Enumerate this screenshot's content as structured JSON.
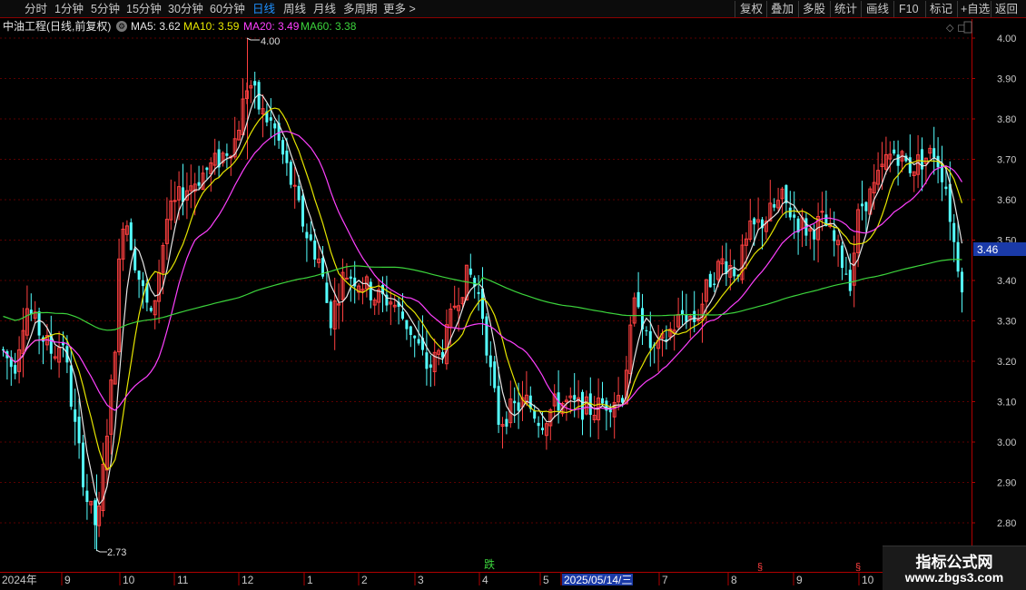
{
  "toolbar": {
    "left": [
      "分时",
      "1分钟",
      "5分钟",
      "15分钟",
      "30分钟",
      "60分钟",
      "日线",
      "周线",
      "月线",
      "多周期",
      "更多 >"
    ],
    "right": [
      "复权",
      "叠加",
      "多股",
      "统计",
      "画线",
      "F10",
      "标记",
      "+自选",
      "返回"
    ],
    "active": "日线"
  },
  "indicators": {
    "title": "中油工程(日线,前复权)",
    "ma5": "MA5: 3.62",
    "ma10": "MA10: 3.59",
    "ma20": "MA20: 3.49",
    "ma60": "MA60: 3.38"
  },
  "chart_data": {
    "type": "candlestick",
    "y_axis_labels": [
      "4.00",
      "3.90",
      "3.80",
      "3.70",
      "3.60",
      "3.50",
      "3.40",
      "3.30",
      "3.20",
      "3.10",
      "3.00",
      "2.90",
      "2.80"
    ],
    "ylim": [
      2.72,
      4.03
    ],
    "x_axis_labels": [
      "2024年",
      "9",
      "10",
      "11",
      "12",
      "1",
      "2",
      "3",
      "4",
      "5",
      "2025/05/14/三",
      "7",
      "8",
      "9",
      "10"
    ],
    "current_price": "3.46",
    "high_label": "4.00",
    "low_label": "2.73",
    "event_markers": [
      "跌",
      "§",
      "§"
    ],
    "series": [
      {
        "name": "MA5",
        "color": "#e6e6e6"
      },
      {
        "name": "MA10",
        "color": "#e6e600"
      },
      {
        "name": "MA20",
        "color": "#ff40ff"
      },
      {
        "name": "MA60",
        "color": "#3cd43c"
      }
    ],
    "colors": {
      "up": "#ff4040",
      "down": "#54ffff",
      "grid": "#8b0000"
    }
  },
  "watermark": {
    "title": "指标公式网",
    "url": "www.zbgs3.com"
  }
}
